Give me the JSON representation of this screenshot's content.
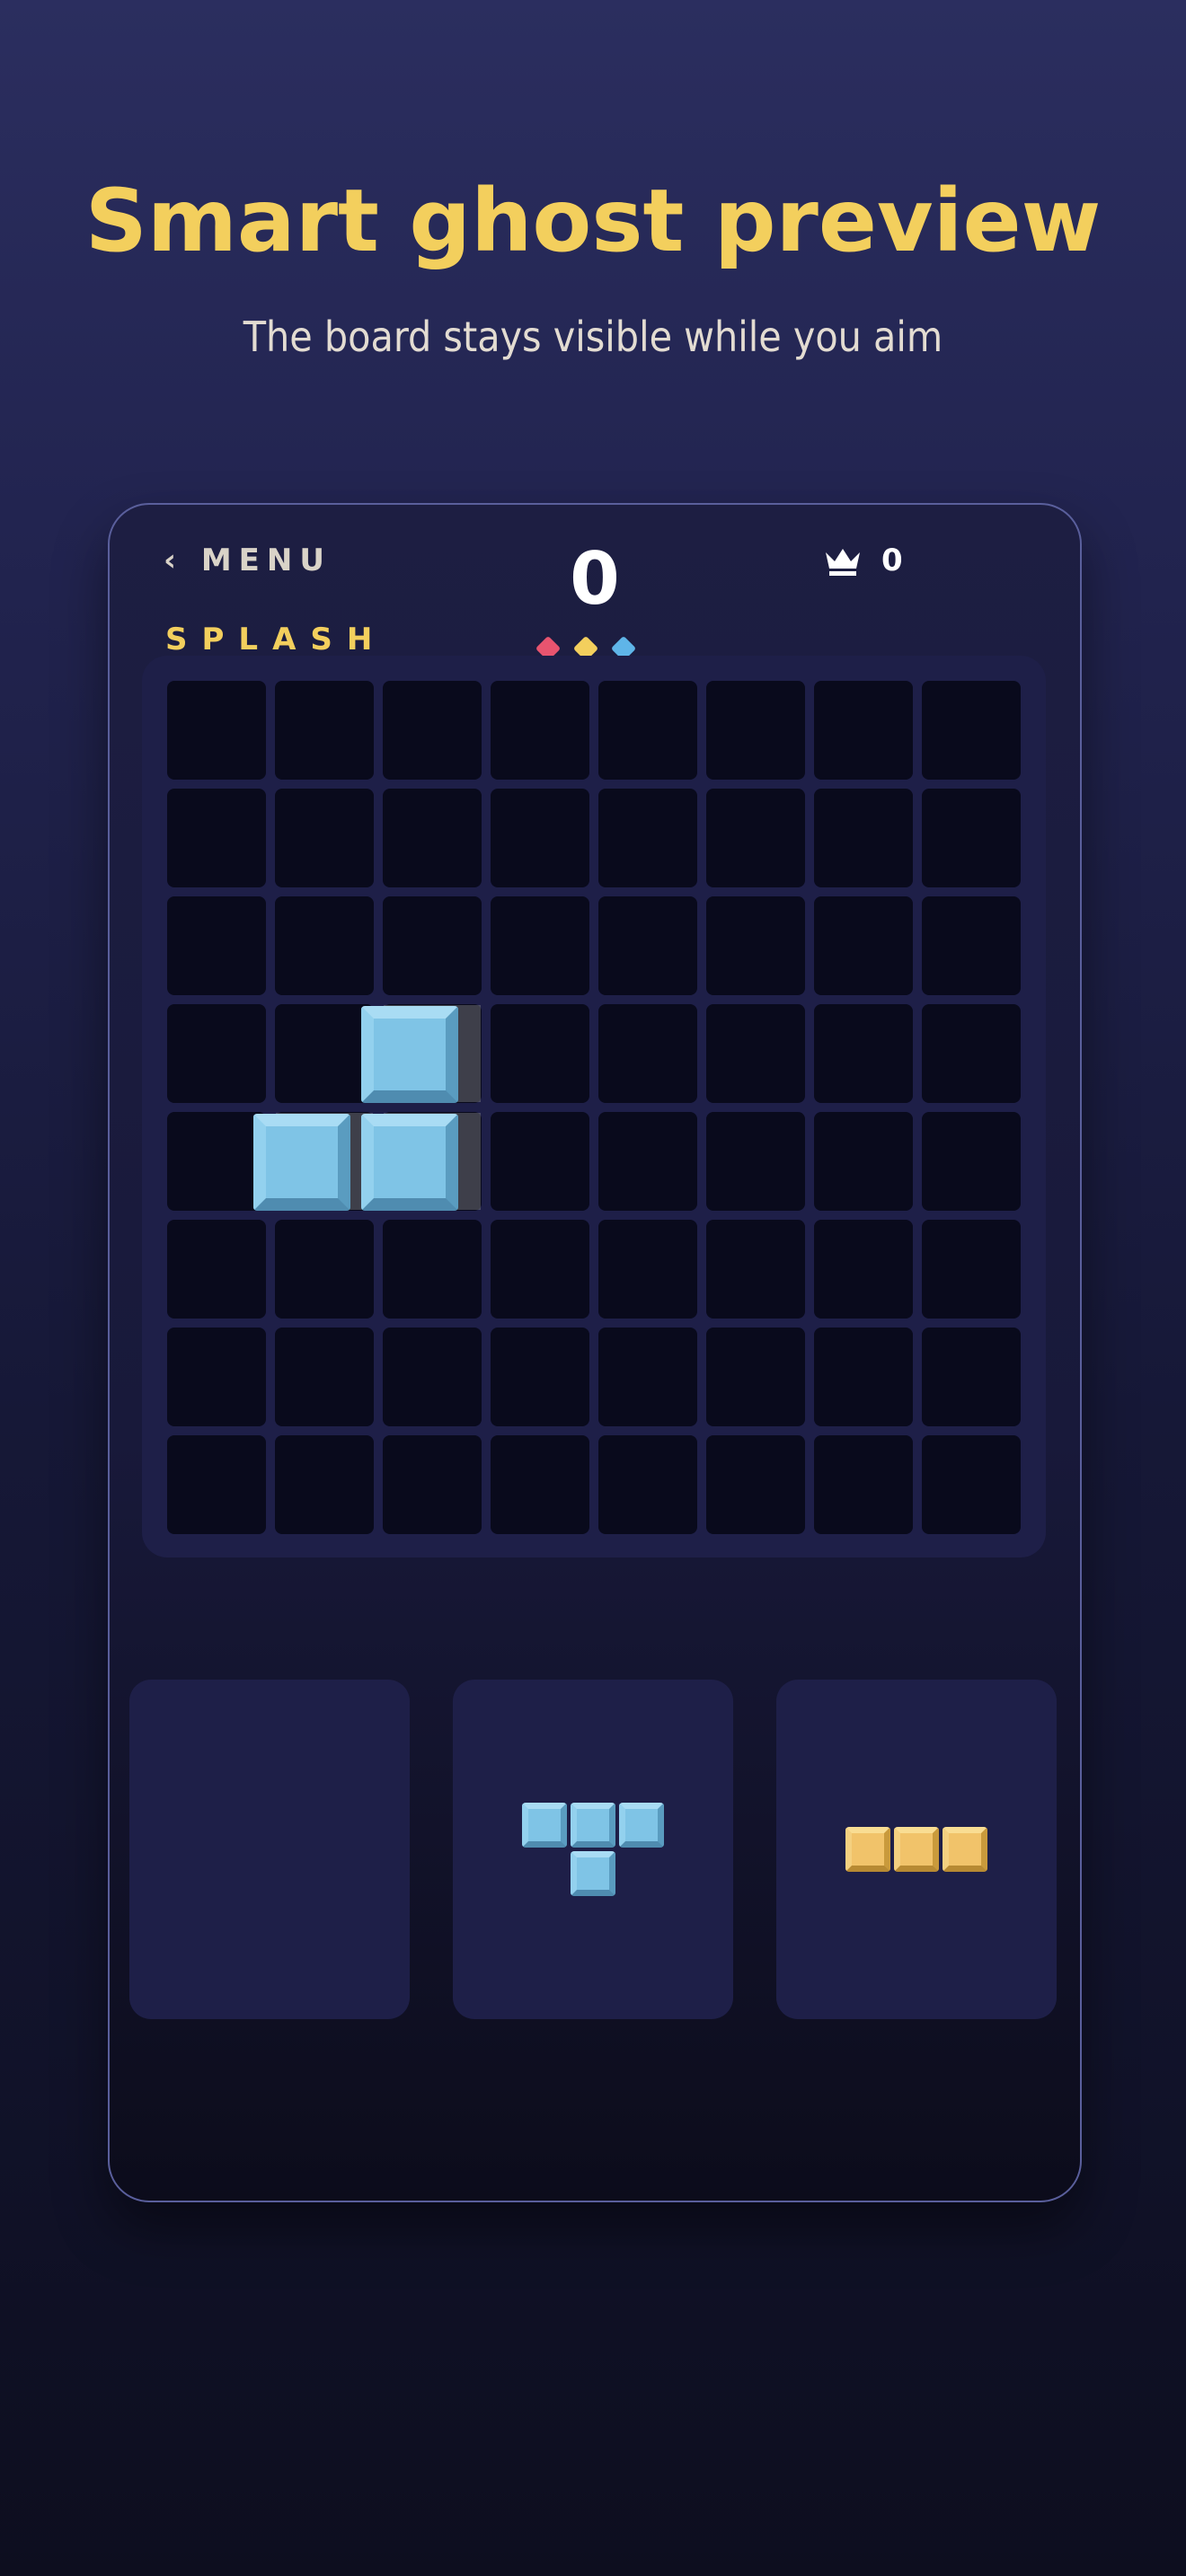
{
  "headline": "Smart ghost preview",
  "subheadline": "The board stays visible while you aim",
  "game": {
    "menu_label": "‹ MENU",
    "score": "0",
    "best_score": "0",
    "best_icon": "crown-icon",
    "mode_label": "SPLASH",
    "mode_gems": [
      "#e8546f",
      "#f3cf5d",
      "#5fb5e8"
    ],
    "board": {
      "rows": 8,
      "cols": 8,
      "ghost_cells": [
        [
          3,
          2
        ],
        [
          4,
          1
        ],
        [
          4,
          2
        ]
      ],
      "dragging_piece": {
        "color": "blue",
        "cells": [
          [
            3,
            2
          ],
          [
            4,
            1
          ],
          [
            4,
            2
          ]
        ]
      }
    },
    "tray": [
      {
        "slot": 1,
        "piece": null
      },
      {
        "slot": 2,
        "piece": {
          "color": "blue",
          "shape": "T",
          "cells": [
            [
              0,
              0
            ],
            [
              0,
              1
            ],
            [
              0,
              2
            ],
            [
              1,
              1
            ]
          ]
        }
      },
      {
        "slot": 3,
        "piece": {
          "color": "gold",
          "shape": "I3",
          "cells": [
            [
              0,
              0
            ],
            [
              0,
              1
            ],
            [
              0,
              2
            ]
          ]
        }
      }
    ]
  },
  "colors": {
    "accent": "#f3cf5d",
    "block_blue": "#7fc4e6",
    "block_gold": "#f1c36a",
    "cell": "#090a1c",
    "panel": "#1e1f48"
  }
}
